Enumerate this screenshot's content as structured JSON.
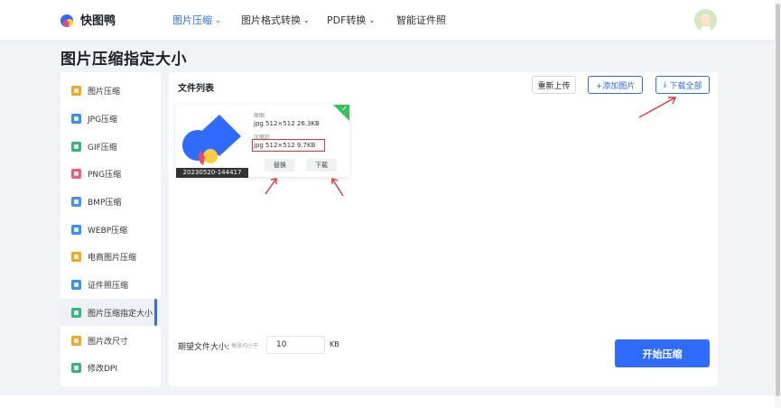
{
  "brand": {
    "name": "快图鸭"
  },
  "nav": [
    {
      "label": "图片压缩",
      "has_dropdown": true,
      "active": true
    },
    {
      "label": "图片格式转换",
      "has_dropdown": true,
      "active": false
    },
    {
      "label": "PDF转换",
      "has_dropdown": true,
      "active": false
    },
    {
      "label": "智能证件照",
      "has_dropdown": false,
      "active": false
    }
  ],
  "page_title": "图片压缩指定大小",
  "sidebar": {
    "items": [
      {
        "label": "图片压缩",
        "icon": "compress-icon",
        "color": "#f5a623"
      },
      {
        "label": "JPG压缩",
        "icon": "jpg-icon",
        "color": "#3a8ef6"
      },
      {
        "label": "GIF压缩",
        "icon": "gif-icon",
        "color": "#36b37e"
      },
      {
        "label": "PNG压缩",
        "icon": "png-icon",
        "color": "#f05a7e"
      },
      {
        "label": "BMP压缩",
        "icon": "bmp-icon",
        "color": "#4a90e2"
      },
      {
        "label": "WEBP压缩",
        "icon": "webp-icon",
        "color": "#3a8ef6"
      },
      {
        "label": "电商图片压缩",
        "icon": "ecommerce-icon",
        "color": "#f5a623"
      },
      {
        "label": "证件照压缩",
        "icon": "id-photo-icon",
        "color": "#3a8ef6"
      },
      {
        "label": "图片压缩指定大小",
        "icon": "target-size-icon",
        "color": "#36b37e",
        "active": true
      },
      {
        "label": "图片改尺寸",
        "icon": "resize-icon",
        "color": "#f5a623"
      },
      {
        "label": "修改DPI",
        "icon": "dpi-icon",
        "color": "#36b37e"
      }
    ]
  },
  "main": {
    "list_title": "文件列表",
    "buttons": {
      "reupload": "重新上传",
      "add_image": "+添加图片",
      "download_all": "下载全部"
    },
    "file": {
      "thumb_caption": "20230520-144417",
      "original_label": "原图",
      "original_value": "jpg  512×512  26.3KB",
      "compressed_label": "压缩后",
      "compressed_value": "jpg  512×512  9.7KB",
      "replace_label": "替换",
      "download_label": "下载"
    },
    "target_size": {
      "label": "期望文件大小:",
      "sub_label": "每张均小于",
      "value": "10",
      "unit": "KB"
    },
    "start_button": "开始压缩"
  },
  "colors": {
    "accent": "#2f6bff",
    "success": "#36c25a",
    "annotation": "#d9363e"
  }
}
